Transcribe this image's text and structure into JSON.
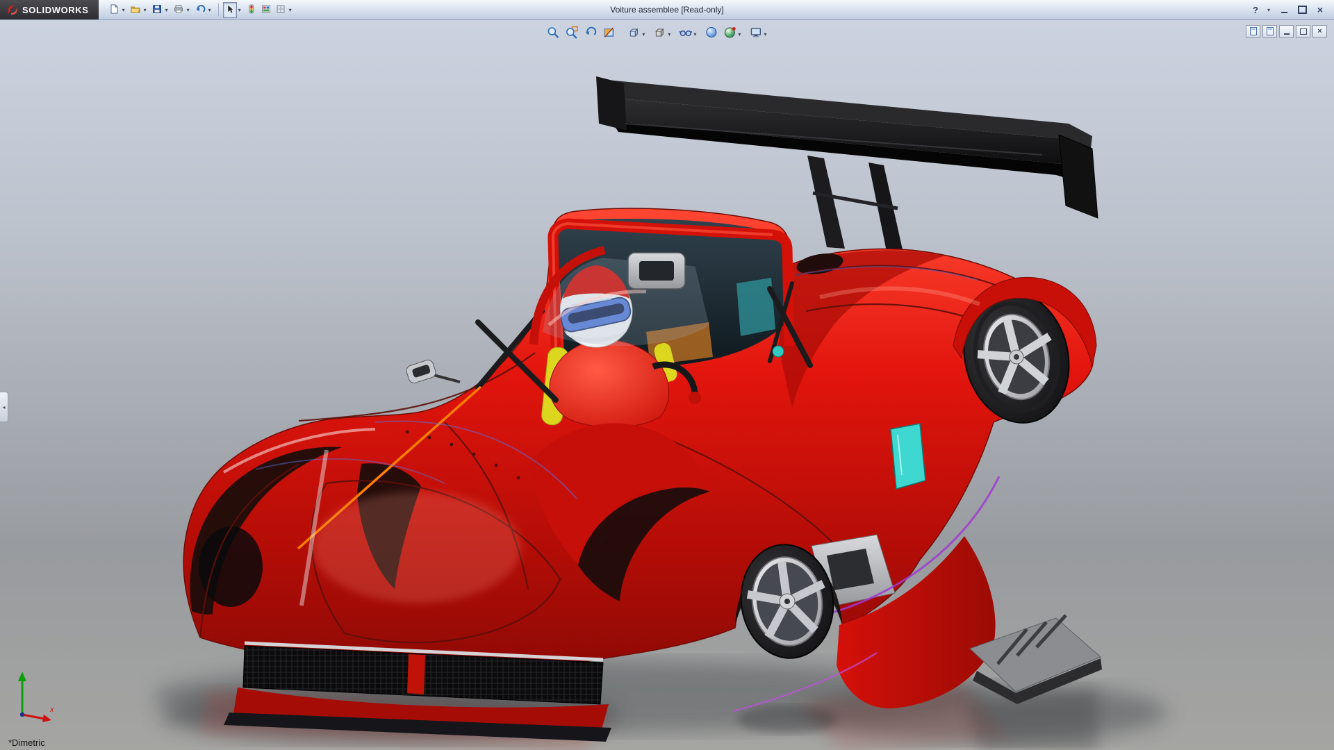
{
  "window": {
    "brand": "SOLIDWORKS",
    "title": "Voiture assemblee [Read-only]",
    "help_label": "?"
  },
  "main_toolbar": {
    "items": [
      "New",
      "Open",
      "Save",
      "Print",
      "Undo",
      "Select",
      "Rebuild",
      "Color Display Mode",
      "Options"
    ]
  },
  "headsup_toolbar": {
    "items": [
      "Zoom to Fit",
      "Zoom to Area",
      "Previous View",
      "Section View",
      "View Orientation",
      "Display Style",
      "Hide/Show Items",
      "Edit Appearance",
      "Apply Scene",
      "View Settings"
    ]
  },
  "doc_controls": {
    "items": [
      "Previous Window",
      "Next Window",
      "Minimize",
      "Restore",
      "Close"
    ]
  },
  "viewport": {
    "view_label": "*Dimetric",
    "triad": {
      "x_label": "x"
    }
  },
  "model": {
    "colors": {
      "body_red": "#e2150d",
      "wing_black": "#111111",
      "sketch_orange": "#ff7f00",
      "glass_teal": "#3fd8d0",
      "accent_purple": "#a03ad0",
      "rim_silver": "#c9cbcf"
    }
  }
}
